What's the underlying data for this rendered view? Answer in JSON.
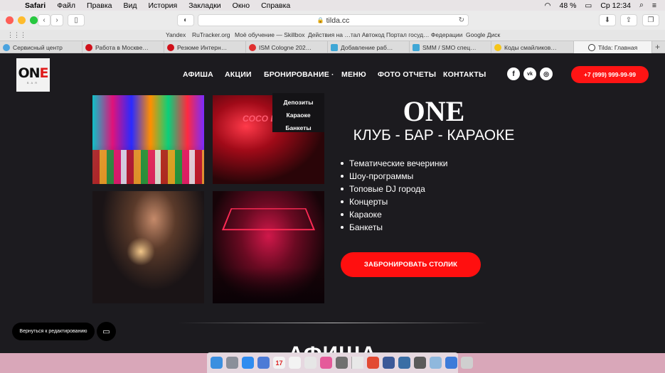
{
  "menubar": {
    "items": [
      "Safari",
      "Файл",
      "Правка",
      "Вид",
      "История",
      "Закладки",
      "Окно",
      "Справка"
    ],
    "battery": "48 %",
    "clock": "Ср 12:34"
  },
  "browser": {
    "url": "tilda.cc",
    "favorites": [
      "Yandex",
      "RuTracker.org",
      "Моё обучение — Skillbox",
      "Действия на …тал Автокод",
      "Портал госуд… Федерации",
      "Google Диск"
    ],
    "tabs": [
      {
        "label": "Сервисный центр",
        "color": "#4aa3df"
      },
      {
        "label": "Работа в Москве…",
        "color": "#d0101a"
      },
      {
        "label": "Резюме Интерн…",
        "color": "#d0101a"
      },
      {
        "label": "ISM Cologne 202…",
        "color": "#e03030"
      },
      {
        "label": "Добавление раб…",
        "color": "#3fa7d6"
      },
      {
        "label": "SMM / SMO спец…",
        "color": "#3fa7d6"
      },
      {
        "label": "Коды смайликов…",
        "color": "#f5c518"
      },
      {
        "label": "Tilda: Главная",
        "color": "#333333"
      }
    ]
  },
  "site": {
    "logo": {
      "text_a": "ON",
      "text_b": "E",
      "sub": "BAR"
    },
    "nav": [
      "АФИША",
      "АКЦИИ",
      "БРОНИРОВАНИЕ ·",
      "МЕНЮ",
      "ФОТО ОТЧЕТЫ",
      "КОНТАКТЫ"
    ],
    "social": [
      "f",
      "vk",
      "ig"
    ],
    "phone": "+7 (999) 999-99-99",
    "dropdown": [
      "Депозиты",
      "Караоке",
      "Банкеты"
    ],
    "photo_sign": "COCO LA",
    "title": "ONE",
    "subtitle": "КЛУБ - БАР - КАРАОКЕ",
    "features": [
      "Тематические вечеринки",
      "Шоу-программы",
      "Топовые DJ города",
      "Концерты",
      "Караоке",
      "Банкеты"
    ],
    "book_button": "ЗАБРОНИРОВАТЬ СТОЛИК",
    "section_title": "АФИША",
    "edit_button": "Вернуться к редактированию",
    "accent": "#ff1414"
  }
}
